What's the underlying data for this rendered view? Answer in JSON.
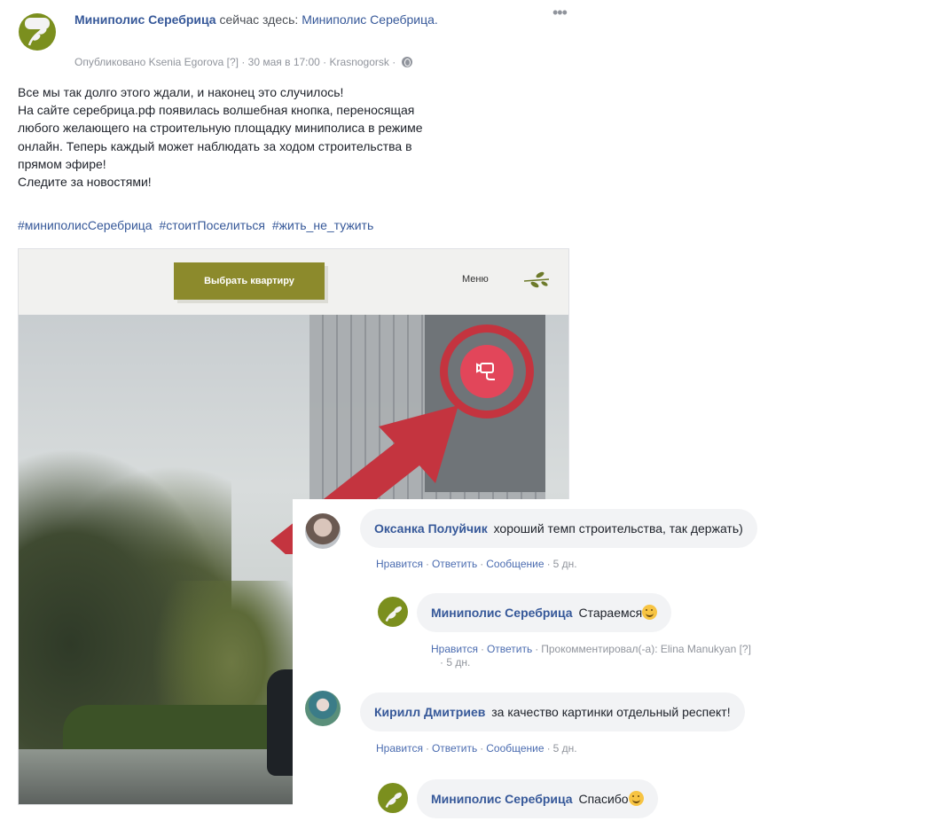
{
  "post": {
    "author": "Миниполис Серебрица",
    "action": "сейчас здесь:",
    "location": "Миниполис Серебрица.",
    "meta": "Опубликовано Ksenia Egorova [?] · 30 мая в 17:00 · Krasnogorsk ·",
    "more": "•••",
    "text_lines": [
      "Все мы так долго этого ждали, и наконец это случилось!",
      "На сайте серебрица.рф появилась волшебная кнопка, переносящая",
      "любого желающего на строительную площадку миниполиса в режиме",
      "онлайн. Теперь каждый может наблюдать за ходом строительства в",
      "прямом эфире!",
      "Следите за новостями!"
    ],
    "hashtags": [
      "#миниполисСеребрица",
      "#стоитПоселиться",
      "#жить_не_тужить"
    ]
  },
  "image": {
    "select_button": "Выбрать квартиру",
    "menu_label": "Меню"
  },
  "comments": [
    {
      "name": "Оксанка Полуйчик",
      "text": "хороший темп строительства, так держать)",
      "actions": [
        "Нравится",
        "Ответить",
        "Сообщение"
      ],
      "time": "5 дн."
    },
    {
      "name": "Миниполис Серебрица",
      "text": "Стараемся",
      "actions": [
        "Нравится",
        "Ответить"
      ],
      "extra": "Прокомментировал(-а): Elina Manukyan [?]",
      "time": "· 5 дн."
    },
    {
      "name": "Кирилл Дмитриев",
      "text": "за качество картинки отдельный респект!",
      "actions": [
        "Нравится",
        "Ответить",
        "Сообщение"
      ],
      "time": "5 дн."
    },
    {
      "name": "Миниполис Серебрица",
      "text": "Спасибо"
    }
  ],
  "colors": {
    "link": "#365899",
    "brand_green": "#7b8f1e",
    "button_olive": "#8c8a2c",
    "camera_red": "#e2465a",
    "arrow_red": "#c4343f"
  }
}
